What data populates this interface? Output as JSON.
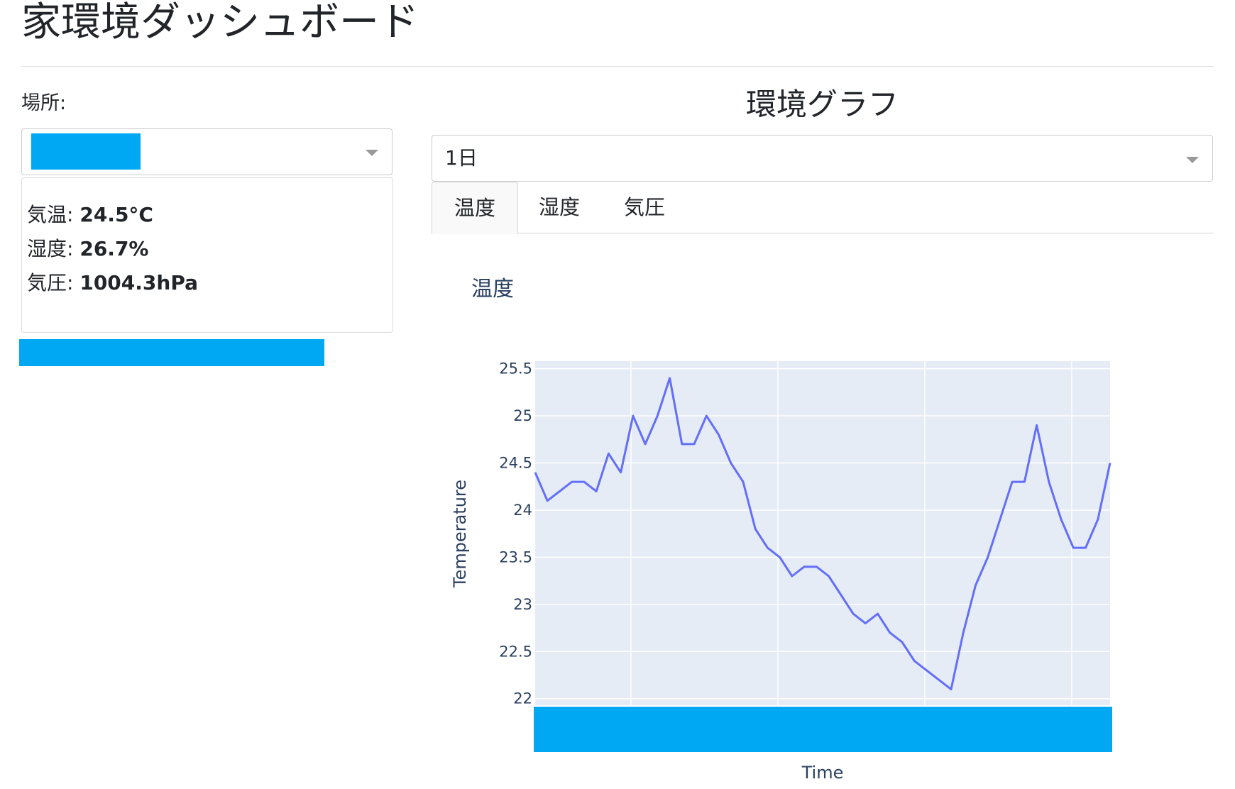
{
  "header": {
    "title": "家環境ダッシュボード"
  },
  "location": {
    "label": "場所:",
    "selected_value": ""
  },
  "readings": {
    "temperature_label": "気温:",
    "temperature_value": "24.5°C",
    "humidity_label": "湿度:",
    "humidity_value": "26.7%",
    "pressure_label": "気圧:",
    "pressure_value": "1004.3hPa"
  },
  "graph": {
    "title": "環境グラフ",
    "period_value": "1日",
    "tabs": [
      {
        "label": "温度",
        "active": true
      },
      {
        "label": "湿度",
        "active": false
      },
      {
        "label": "気圧",
        "active": false
      }
    ]
  },
  "colors": {
    "redaction": "#00a8f3",
    "plot_bg": "#e5ecf6",
    "line": "#636efa",
    "axis_text": "#2a3f5f"
  },
  "icons": {
    "dropdown": "caret-down-icon"
  },
  "chart_data": {
    "type": "line",
    "title": "温度",
    "xlabel": "Time",
    "ylabel": "Temperature",
    "ylim": [
      21.93,
      25.58
    ],
    "yticks": [
      22,
      22.5,
      23,
      23.5,
      24,
      24.5,
      25,
      25.5
    ],
    "ytick_labels": [
      "22",
      "22.5",
      "23",
      "23.5",
      "24",
      "24.5",
      "25",
      "25.5"
    ],
    "x_tick_labels_visible": false,
    "grid": true,
    "series": [
      {
        "values": [
          24.4,
          24.1,
          24.2,
          24.3,
          24.3,
          24.2,
          24.6,
          24.4,
          25.0,
          24.7,
          25.0,
          25.4,
          24.7,
          24.7,
          25.0,
          24.8,
          24.5,
          24.3,
          23.8,
          23.6,
          23.5,
          23.3,
          23.4,
          23.4,
          23.3,
          23.1,
          22.9,
          22.8,
          22.9,
          22.7,
          22.6,
          22.4,
          22.3,
          22.2,
          22.1,
          22.7,
          23.2,
          23.5,
          23.9,
          24.3,
          24.3,
          24.9,
          24.3,
          23.9,
          23.6,
          23.6,
          23.9,
          24.5
        ]
      }
    ]
  }
}
